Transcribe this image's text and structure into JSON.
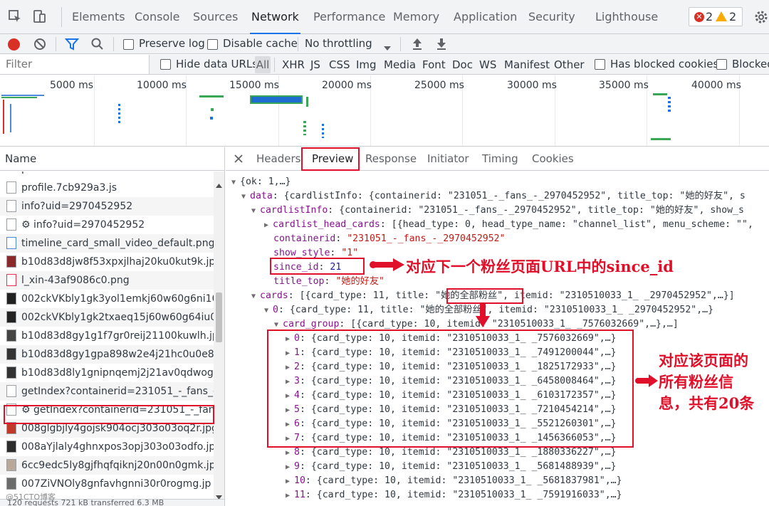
{
  "toolbar_tabs": {
    "elements": "Elements",
    "console": "Console",
    "sources": "Sources",
    "network": "Network",
    "performance": "Performance",
    "memory": "Memory",
    "application": "Application",
    "security": "Security",
    "lighthouse": "Lighthouse",
    "errors": "2",
    "warnings": "2"
  },
  "network_toolbar": {
    "preserve_log": "Preserve log",
    "disable_cache": "Disable cache",
    "throttling": "No throttling"
  },
  "filter": {
    "placeholder": "Filter",
    "hide_data_urls": "Hide data URLs",
    "all": "All",
    "types": [
      "XHR",
      "JS",
      "CSS",
      "Img",
      "Media",
      "Font",
      "Doc",
      "WS",
      "Manifest",
      "Other"
    ],
    "has_blocked_cookies": "Has blocked cookies",
    "blocked_requests": "Blocked"
  },
  "overview": {
    "ticks": [
      "5000 ms",
      "10000 ms",
      "15000 ms",
      "20000 ms",
      "25000 ms",
      "30000 ms",
      "35000 ms",
      "40000 ms"
    ]
  },
  "name_list": {
    "header": "Name",
    "rows": [
      "profile.7cb929a3.js",
      "info?uid=2970452952",
      "⚙ info?uid=2970452952",
      "timeline_card_small_video_default.png",
      "b10d83d8jw8f53xpxjlhaj20ku0kut9k.jpg",
      "l_xin-43af9086c0.png",
      "002ckVKbly1gk3yol1emkj60w60g6ni102",
      "002ckVKbly1gk2txaeq15j60w60g64iu02.",
      "b10d83d8gy1g1f7gr0reij21100kuwlh.jpg",
      "b10d83d8gy1gpa898w2e4j21hc0u0e84.",
      "b10d83d8ly1gnipnqemj2j21av0qdwog.jp",
      "getIndex?containerid=231051_-_fans_-_",
      "⚙ getIndex?containerid=231051_-_fans_",
      "008glgbjly4gojsk904ocj303o03oq2r.jpg",
      "008aYjlaly4ghnxpos3opj303o03odfo.jpg",
      "6cc9edc5ly8gjfhqfqiknj20n00n0gmk.jpg",
      "007ZiVNOly8gnfavhgnni30r0rogmg.jp"
    ],
    "status": "120 requests   721 kB transferred   6.3 MB"
  },
  "detail_tabs": {
    "headers": "Headers",
    "preview": "Preview",
    "response": "Response",
    "initiator": "Initiator",
    "timing": "Timing",
    "cookies": "Cookies"
  },
  "preview": {
    "l1": "{ok: 1,…}",
    "l2_key": "data",
    "l2_val": "{cardlistInfo: {containerid: \"231051_-_fans_-_2970452952\", title_top: \"她的好友\", s",
    "l3_key": "cardlistInfo",
    "l3_val": "{containerid: \"231051_-_fans_-_2970452952\", title_top: \"她的好友\", show_s",
    "l4_key": "cardlist_head_cards",
    "l4_val": "[{head_type: 0, head_type_name: \"channel_list\", menu_scheme: \"\",",
    "l5_key": "containerid",
    "l5_val": "\"231051_-_fans_-_2970452952\"",
    "l6_key": "show_style",
    "l6_val": "\"1\"",
    "l7_key": "since_id",
    "l7_val": "21",
    "l8_key": "title_top",
    "l8_val": "\"她的好友\"",
    "l9_key": "cards",
    "l9_pre": "[{card_type: 11, title: ",
    "l9_title": "\"她的全部粉丝\"",
    "l9_post": ", itemid: \"2310510033_1_ _2970452952\",…}]",
    "l10_key": "0",
    "l10_val": "{card_type: 11, title: \"她的全部粉丝\", itemid: \"2310510033_1_ _2970452952\",…}",
    "l11_key": "card_group",
    "l11_val": "[{card_type: 10, itemid: \"2310510033_1_ _7576032669\",…},…]",
    "items": [
      {
        "idx": "0",
        "val": "{card_type: 10, itemid: \"2310510033_1_ _7576032669\",…}"
      },
      {
        "idx": "1",
        "val": "{card_type: 10, itemid: \"2310510033_1_ _7491200044\",…}"
      },
      {
        "idx": "2",
        "val": "{card_type: 10, itemid: \"2310510033_1_ _1825172933\",…}"
      },
      {
        "idx": "3",
        "val": "{card_type: 10, itemid: \"2310510033_1_ _6458008464\",…}"
      },
      {
        "idx": "4",
        "val": "{card_type: 10, itemid: \"2310510033_1_ _6103172357\",…}"
      },
      {
        "idx": "5",
        "val": "{card_type: 10, itemid: \"2310510033_1_ _7210454214\",…}"
      },
      {
        "idx": "6",
        "val": "{card_type: 10, itemid: \"2310510033_1_ _5521260301\",…}"
      },
      {
        "idx": "7",
        "val": "{card_type: 10, itemid: \"2310510033_1_ _1456366053\",…}"
      },
      {
        "idx": "8",
        "val": "{card_type: 10, itemid: \"2310510033_1_ _1880336227\",…}"
      },
      {
        "idx": "9",
        "val": "{card_type: 10, itemid: \"2310510033_1_ _5681488939\",…}"
      },
      {
        "idx": "10",
        "val": "{card_type: 10, itemid: \"2310510033_1_ _5681837981\",…}"
      },
      {
        "idx": "11",
        "val": "{card_type: 10, itemid: \"2310510033_1_ _7591916033\",…}"
      }
    ]
  },
  "annotations": {
    "since_id_note": "对应下一个粉丝页面URL中的since_id",
    "fans_note_1": "对应该页面的",
    "fans_note_2": "所有粉丝信",
    "fans_note_3": "息，共有20条"
  },
  "watermark": "@51CTO博客",
  "colors": {
    "accent": "#1a73e8",
    "annotation_red": "#e0102a",
    "record_red": "#d93025"
  }
}
